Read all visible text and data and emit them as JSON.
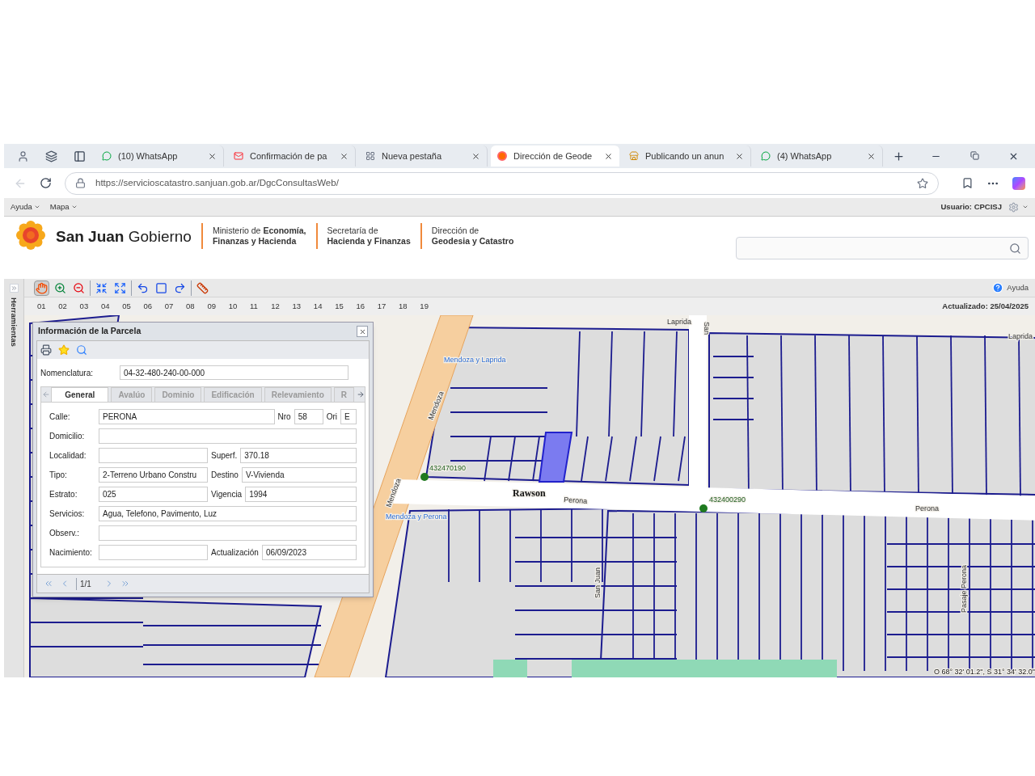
{
  "browser": {
    "tabs": [
      {
        "title": "(10) WhatsApp",
        "kind": "chat",
        "selected": false
      },
      {
        "title": "Confirmación de pa",
        "kind": "mail",
        "selected": false
      },
      {
        "title": "Nueva pestaña",
        "kind": "page",
        "selected": false
      },
      {
        "title": "Dirección de Geode",
        "kind": "flower",
        "selected": true
      },
      {
        "title": "Publicando un anun",
        "kind": "shop",
        "selected": false
      },
      {
        "title": "(4) WhatsApp",
        "kind": "chat",
        "selected": false
      }
    ],
    "url": "https://servicioscatastro.sanjuan.gob.ar/DgcConsultasWeb/"
  },
  "app": {
    "menu": [
      "Ayuda",
      "Mapa"
    ],
    "user": "Usuario: CPCISJ",
    "brand": "**San Juan** Gobierno",
    "agencies": [
      {
        "lines": [
          "Ministerio de **Economía,**",
          "**Finanzas y Hacienda**"
        ]
      },
      {
        "lines": [
          "Secretaría de",
          "**Hacienda y Finanzas**"
        ]
      },
      {
        "lines": [
          "Dirección de",
          "**Geodesia y Catastro**"
        ]
      }
    ]
  },
  "sidebar": {
    "label": "Herramientas"
  },
  "tool_groups": [
    [
      {
        "kind": "pan",
        "selected": true
      },
      {
        "kind": "zoom_in",
        "selected": false
      },
      {
        "kind": "zoom_out",
        "selected": false
      }
    ],
    [
      {
        "kind": "extent_in",
        "selected": false
      },
      {
        "kind": "extent_out",
        "selected": false
      }
    ],
    [
      {
        "kind": "undo",
        "selected": false
      },
      {
        "kind": "box",
        "selected": false
      },
      {
        "kind": "redo",
        "selected": false
      }
    ],
    [
      {
        "kind": "measure",
        "selected": false
      }
    ]
  ],
  "help": "Ayuda",
  "layers": [
    "01",
    "02",
    "03",
    "04",
    "05",
    "06",
    "07",
    "08",
    "09",
    "10",
    "11",
    "12",
    "13",
    "14",
    "15",
    "16",
    "17",
    "18",
    "19"
  ],
  "updated": "Actualizado: 25/04/2025",
  "panel": {
    "title": "Información de la Parcela",
    "nomenclature": {
      "label": "Nomenclatura:",
      "value": "04-32-480-240-00-000"
    },
    "tabs": [
      {
        "label": "General",
        "selected": true
      },
      {
        "label": "Avalúo",
        "selected": false
      },
      {
        "label": "Dominio",
        "selected": false
      },
      {
        "label": "Edificación",
        "selected": false
      },
      {
        "label": "Relevamiento",
        "selected": false
      },
      {
        "label": "R",
        "selected": false
      }
    ],
    "form": [
      [
        {
          "label": "Calle:",
          "value": "PERONA"
        },
        {
          "label": "Nro",
          "value": "58"
        },
        {
          "label": "Ori",
          "value": "E"
        }
      ],
      [
        {
          "label": "Domicilio:"
        }
      ],
      [
        {
          "label": "Localidad:"
        },
        {
          "label": "Superf.",
          "value": "370.18"
        }
      ],
      [
        {
          "label": "Tipo:",
          "value": "2-Terreno Urbano Constru"
        },
        {
          "label": "Destino",
          "value": "V-Vivienda"
        }
      ],
      [
        {
          "label": "Estrato:",
          "value": "025"
        },
        {
          "label": "Vigencia",
          "value": "1994"
        }
      ],
      [
        {
          "label": "Servicios:",
          "value": "Agua, Telefono, Pavimento, Luz"
        }
      ],
      [
        {
          "label": "Observ.:"
        }
      ],
      [
        {
          "label": "Nacimiento:"
        },
        {
          "label": "Actualización",
          "value": "06/09/2023"
        }
      ]
    ],
    "pager": "1/1"
  },
  "map": {
    "labels": [
      {
        "text": "Laprida",
        "kind": "street"
      },
      {
        "text": "Laprida",
        "kind": "street"
      },
      {
        "text": "San",
        "kind": "street"
      },
      {
        "text": "Mendoza",
        "kind": "street"
      },
      {
        "text": "Mendoza",
        "kind": "street"
      },
      {
        "text": "Mendoza y Laprida",
        "kind": "stop"
      },
      {
        "text": "Mendoza y Perona",
        "kind": "stop"
      },
      {
        "text": "Rawson",
        "kind": "district"
      },
      {
        "text": "Perona",
        "kind": "street"
      },
      {
        "text": "Perona",
        "kind": "street"
      },
      {
        "text": "432470190",
        "kind": "point"
      },
      {
        "text": "432400290",
        "kind": "point"
      },
      {
        "text": "San Juan",
        "kind": "street"
      },
      {
        "text": "Pasaje Perona",
        "kind": "street"
      },
      {
        "text": "O 68° 32' 01.2\", S 31° 34' 32.0\"",
        "kind": "coords"
      }
    ]
  }
}
